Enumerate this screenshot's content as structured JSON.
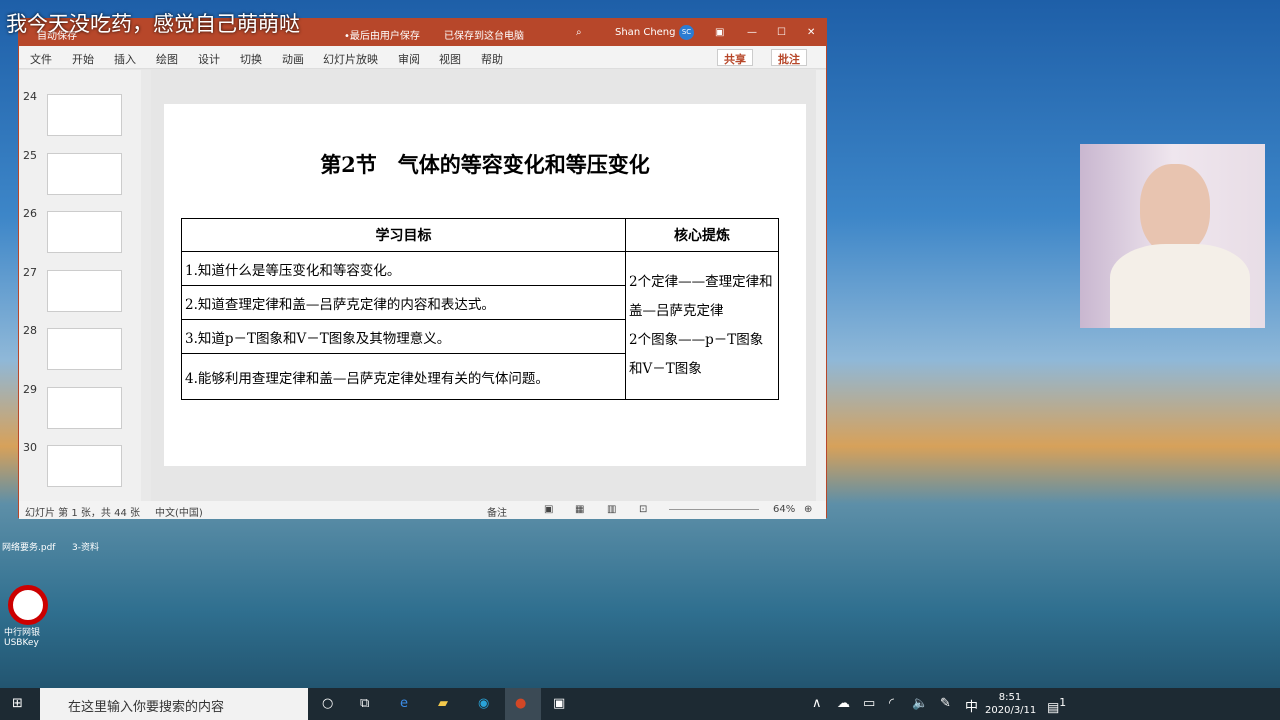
{
  "overlay_text": "我今天没吃药，感觉自己萌萌哒",
  "titlebar": {
    "autosave": "自动保存",
    "saved_by": "•最后由用户保存",
    "saved_to": "已保存到这台电脑",
    "user": "Shan Cheng",
    "avatar": "SC"
  },
  "ribbon": {
    "tabs": [
      "文件",
      "开始",
      "插入",
      "绘图",
      "设计",
      "切换",
      "动画",
      "幻灯片放映",
      "审阅",
      "视图",
      "帮助"
    ],
    "share": "共享",
    "comment": "批注"
  },
  "thumbnails": [
    "24",
    "25",
    "26",
    "27",
    "28",
    "29",
    "30"
  ],
  "slide": {
    "title": "第2节　气体的等容变化和等压变化",
    "header_left": "学习目标",
    "header_right": "核心提炼",
    "goals": [
      "1.知道什么是等压变化和等容变化。",
      "2.知道查理定律和盖—吕萨克定律的内容和表达式。",
      "3.知道p－T图象和V－T图象及其物理意义。",
      "4.能够利用查理定律和盖—吕萨克定律处理有关的气体问题。"
    ],
    "core": [
      "2个定律——查理定律和盖—吕萨克定律",
      "2个图象——p－T图象和V－T图象"
    ]
  },
  "status": {
    "slide_info": "幻灯片 第 1 张，共 44 张",
    "language": "中文(中国)",
    "notes": "备注",
    "zoom": "64%"
  },
  "taskbar": {
    "search_placeholder": "在这里输入你要搜索的内容",
    "ime": "中",
    "time": "8:51",
    "date": "2020/3/11",
    "notifications": "1"
  },
  "desktop_icons": [
    "网络要务.pdf",
    "3-资料",
    "中行网银USBKey"
  ]
}
